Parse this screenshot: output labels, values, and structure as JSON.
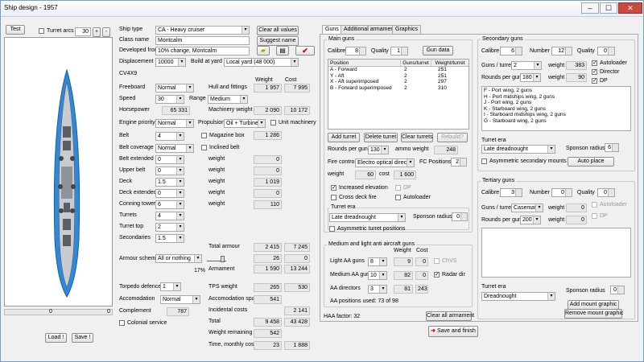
{
  "window": {
    "title": "Ship design - 1957",
    "minimize": "–",
    "maximize": "☐",
    "close": "✕"
  },
  "left": {
    "test": "Test",
    "turret_arcs": "Turret arcs",
    "arc_value": "30",
    "plus": "+",
    "minus": "-",
    "scroll_left_value": "0",
    "scroll_right_value": "0",
    "load": "Load !",
    "save": "Save !"
  },
  "mid": {
    "ship_type_label": "Ship type",
    "ship_type": "CA - Heavy cruiser",
    "clear_all": "Clear all values",
    "class_name_label": "Class name",
    "class_name": "Montcalm",
    "suggest_name": "Suggest name",
    "developed_label": "Developed from",
    "developed": "10% change, Montcalm",
    "displacement_label": "Displacement",
    "displacement": "10000",
    "build_label": "Build at yard",
    "build": "Local yard (48 000)",
    "code": "CV4X9",
    "weight_hdr": "Weight",
    "cost_hdr": "Cost",
    "freeboard_label": "Freeboard",
    "freeboard": "Normal",
    "hull_label": "Hull and fittings",
    "hull_w": "1 957",
    "hull_c": "7 995",
    "speed_label": "Speed",
    "speed": "30",
    "range_label": "Range",
    "range": "Medium",
    "hp_label": "Horsepower",
    "hp": "65 331",
    "mach_label": "Machinery weight",
    "mach_w": "2 090",
    "mach_c": "10 172",
    "engine_label": "Engine priority",
    "engine": "Normal",
    "prop_label": "Propulsion",
    "prop": "Oil + Turbine",
    "unit_mach": "Unit machinery",
    "belt_label": "Belt",
    "belt": "4",
    "mag_box": "Magazine box",
    "mag_w": "1 286",
    "belt_cov_label": "Belt coverage",
    "belt_cov": "Normal",
    "incl_belt": "Inclined belt",
    "belt_ext_label": "Belt extended",
    "belt_ext": "0",
    "belt_ext_wl": "weight",
    "belt_ext_w": "0",
    "upper_belt_label": "Upper belt",
    "upper_belt": "0",
    "upper_wl": "weight",
    "upper_w": "0",
    "deck_label": "Deck",
    "deck": "1.5",
    "deck_wl": "weight",
    "deck_w": "1 019",
    "deck_ext_label": "Deck extended",
    "deck_ext": "0",
    "deck_ext_wl": "weight",
    "deck_ext_w": "0",
    "ct_label": "Conning tower",
    "ct": "6",
    "ct_wl": "weight",
    "ct_w": "110",
    "turrets_label": "Turrets",
    "turrets": "4",
    "turret_top_label": "Turret top",
    "turret_top": "2",
    "secondaries_label": "Secondaries",
    "secondaries": "1.5",
    "total_armour_label": "Total armour",
    "ta_w": "2 415",
    "ta_c": "7 245",
    "armour_scheme_label": "Armour scheme",
    "armour_scheme": "All or nothing",
    "as_w": "26",
    "as_c": "0",
    "pct": "17%",
    "armament_label": "Armament",
    "arm_w": "1 590",
    "arm_c": "13 244",
    "torpedo_label": "Torpedo defence",
    "torpedo": "1",
    "tps_label": "TPS weight",
    "tps_w": "265",
    "tps_c": "530",
    "accom_label": "Accomodation",
    "accom": "Normal",
    "accom_space_label": "Accomodation space",
    "accom_space": "541",
    "complement_label": "Complement",
    "complement": "787",
    "incidental_label": "Incidental costs",
    "incidental": "2 141",
    "colonial": "Colonial service",
    "total_label": "Total",
    "total_w": "9 458",
    "total_c": "43 428",
    "weight_rem_label": "Weight remaining",
    "weight_rem": "542",
    "time_label": "Time, monthly cost",
    "time": "23",
    "monthly": "1 888"
  },
  "tabs": [
    "Guns",
    "Additional armament",
    "Graphics"
  ],
  "main_guns": {
    "title": "Main guns",
    "calibre_label": "Calibre",
    "calibre": "8",
    "quality_label": "Quality",
    "quality": "1",
    "gun_data": "Gun data",
    "headers": [
      "Position",
      "Guns/turret",
      "Weight/turret"
    ],
    "rows": [
      [
        "A - Forward",
        "2",
        "251"
      ],
      [
        "Y - Aft",
        "2",
        "251"
      ],
      [
        "X - Aft superimposed",
        "2",
        "297"
      ],
      [
        "B - Forward superimposed",
        "2",
        "310"
      ]
    ],
    "add_turret": "Add turret",
    "delete_turret": "Delete turret",
    "clear_turrets": "Clear turrets",
    "rebuild": "Rebuild?",
    "rpg_label": "Rounds per gun",
    "rpg": "130",
    "ammo_label": "ammo weight",
    "ammo": "248",
    "fc_label": "Fire control",
    "fc": "Electro optical director",
    "fcpos_label": "FC Positions",
    "fcpos": "2",
    "weight_label": "weight",
    "fc_w": "60",
    "cost_label": "cost",
    "fc_c": "1 600",
    "inc_elev": "Increased elevation",
    "dp": "DP",
    "cross_deck": "Cross deck fire",
    "autoloader": "Autoloader",
    "turret_era_label": "Turret era",
    "turret_era": "Late dreadnought",
    "sponson_label": "Sponson radius",
    "sponson": "0",
    "asym": "Asymmetric turret positions"
  },
  "aa": {
    "title": "Medium and light anti aircraft guns",
    "weight_hdr": "Weight",
    "cost_hdr": "Cost",
    "light_label": "Light AA guns",
    "light": "8",
    "light_w": "9",
    "light_c": "0",
    "chvs": "ChVS",
    "medium_label": "Medium AA guns",
    "medium": "10",
    "medium_w": "82",
    "medium_c": "0",
    "radar": "Radar dir",
    "dir_label": "AA directors",
    "dir": "3",
    "dir_w": "81",
    "dir_c": "243",
    "positions": "AA positions used: 73 of 98"
  },
  "haa": "HAA factor: 32",
  "clear_all_arm": "Clear all armament",
  "save_finish": "Save and finish",
  "secondary": {
    "title": "Secondary guns",
    "calibre_label": "Calibre",
    "calibre": "6",
    "number_label": "Number",
    "number": "12",
    "quality_label": "Quality",
    "quality": "0",
    "gpt_label": "Guns / turret",
    "gpt": "2",
    "weight_label": "weight",
    "weight": "383",
    "autoloader": "Autoloader",
    "rpg_label": "Rounds per gun",
    "rpg": "180",
    "weight2": "90",
    "director": "Director",
    "dp": "DP",
    "list": [
      "F - Port wing, 2 guns",
      "H - Port midships wing, 2 guns",
      "J - Port wing, 2 guns",
      "K - Starboard wing, 2 guns",
      "I - Starboard midships wing, 2 guns",
      "G - Starboard wing, 2 guns"
    ],
    "turret_era_label": "Turret era",
    "turret_era": "Late dreadnought",
    "sponson_label": "Sponson radius",
    "sponson": "6",
    "asym": "Asymmetric secondary mounts",
    "auto_place": "Auto place"
  },
  "tertiary": {
    "title": "Tertiary guns",
    "calibre_label": "Calibre",
    "calibre": "3",
    "number_label": "Number",
    "number": "0",
    "quality_label": "Quality",
    "quality": "0",
    "gpt_label": "Guns / turret",
    "gpt": "Casemat",
    "weight_label": "weight",
    "weight": "0",
    "autoloader": "Autoloader",
    "rpg_label": "Rounds per gun",
    "rpg": "200",
    "weight2": "0",
    "dp": "DP",
    "turret_era_label": "Turret era",
    "turret_era": "Dreadnought",
    "sponson_label": "Sponson radius",
    "sponson": "0",
    "add_mount": "Add mount graphic",
    "remove_mount": "Remove mount graphic"
  },
  "colors": {
    "sea": "#2f89d6",
    "hull": "#c8ccd0",
    "save_icon": "#cc0000"
  }
}
